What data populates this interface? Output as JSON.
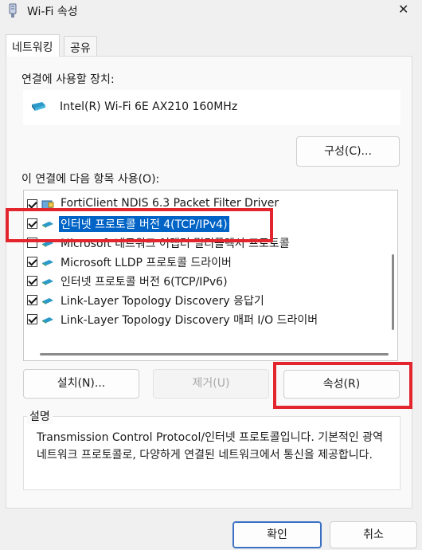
{
  "window": {
    "title": "Wi-Fi 속성",
    "close_glyph": "✕"
  },
  "tabs": [
    {
      "label": "네트워킹",
      "active": true
    },
    {
      "label": "공유",
      "active": false
    }
  ],
  "connection": {
    "label": "연결에 사용할 장치:",
    "device_name": "Intel(R) Wi-Fi 6E AX210 160MHz",
    "configure_button": "구성(C)..."
  },
  "items_section": {
    "label": "이 연결에 다음 항목 사용(O):",
    "items": [
      {
        "text": "FortiClient NDIS 6.3 Packet Filter Driver",
        "checked": true,
        "icon": "filter-driver-icon",
        "selected": false
      },
      {
        "text": "인터넷 프로토콜 버전 4(TCP/IPv4)",
        "checked": true,
        "icon": "network-protocol-icon",
        "selected": true
      },
      {
        "text": "Microsoft 네트워크 어댑터 멀티플렉서 프로토콜",
        "checked": false,
        "icon": "network-protocol-icon",
        "selected": false
      },
      {
        "text": "Microsoft LLDP 프로토콜 드라이버",
        "checked": true,
        "icon": "network-protocol-icon",
        "selected": false
      },
      {
        "text": "인터넷 프로토콜 버전 6(TCP/IPv6)",
        "checked": true,
        "icon": "network-protocol-icon",
        "selected": false
      },
      {
        "text": "Link-Layer Topology Discovery 응답기",
        "checked": true,
        "icon": "network-protocol-icon",
        "selected": false
      },
      {
        "text": "Link-Layer Topology Discovery 매퍼 I/O 드라이버",
        "checked": true,
        "icon": "network-protocol-icon",
        "selected": false
      }
    ]
  },
  "buttons": {
    "install": "설치(N)...",
    "remove": "제거(U)",
    "properties": "속성(R)"
  },
  "description": {
    "label": "설명",
    "text": "Transmission Control Protocol/인터넷 프로토콜입니다. 기본적인 광역 네트워크 프로토콜로, 다양하게 연결된 네트워크에서 통신을 제공합니다."
  },
  "footer": {
    "ok": "확인",
    "cancel": "취소"
  },
  "colors": {
    "selection": "#0063c6",
    "highlight_annotation": "#e3262d",
    "primary_border": "#3a6fc1"
  }
}
